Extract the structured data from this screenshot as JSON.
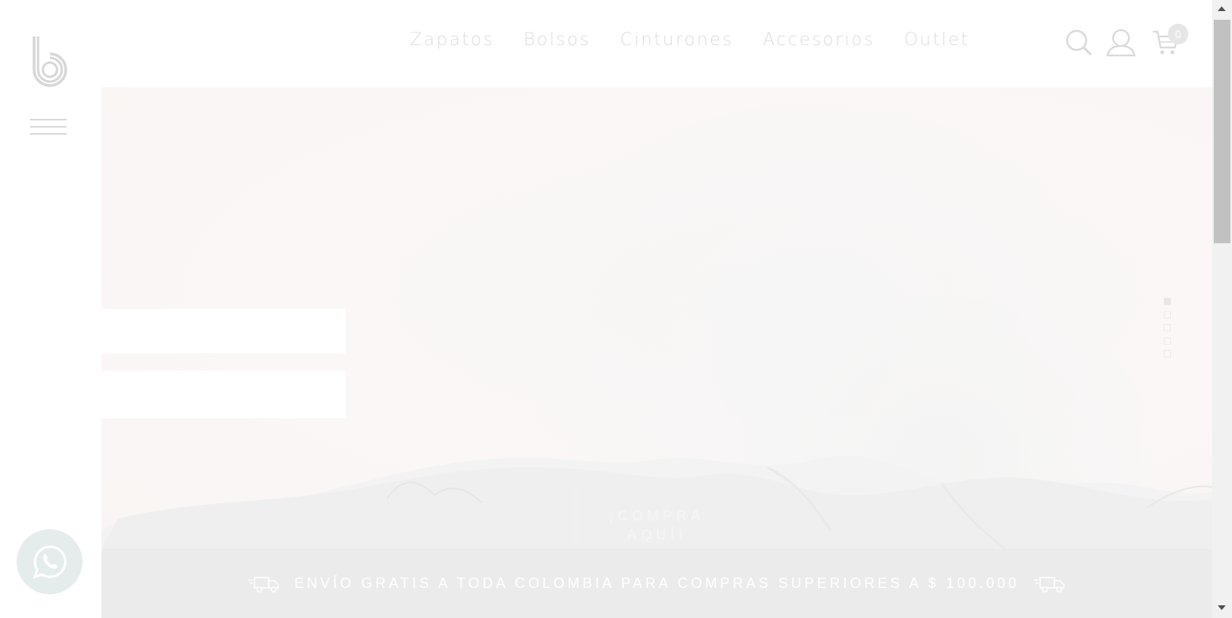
{
  "nav": {
    "items": [
      "Zapatos",
      "Bolsos",
      "Cinturones",
      "Accesorios",
      "Outlet"
    ]
  },
  "header": {
    "cart_count": "0",
    "icons": [
      "search-icon",
      "user-icon",
      "cart-icon"
    ]
  },
  "hero": {
    "cta_label": "¡COMPRA AQUÍ!",
    "slides": 5,
    "active_slide": 1
  },
  "banner": {
    "text": "ENVÍO GRATIS A TODA COLOMBIA PARA COMPRAS SUPERIORES A $ 100.000",
    "icon": "delivery-truck-icon"
  },
  "sidebar": {
    "logo_icon": "brand-b-logo",
    "menu_icon": "hamburger-menu-icon",
    "whatsapp_icon": "whatsapp-icon"
  },
  "colors": {
    "nav_text": "#dcdcdc",
    "hero_bg": "#f9f6f5",
    "banner_bg": "#ebebeb",
    "banner_text": "#ffffff"
  }
}
